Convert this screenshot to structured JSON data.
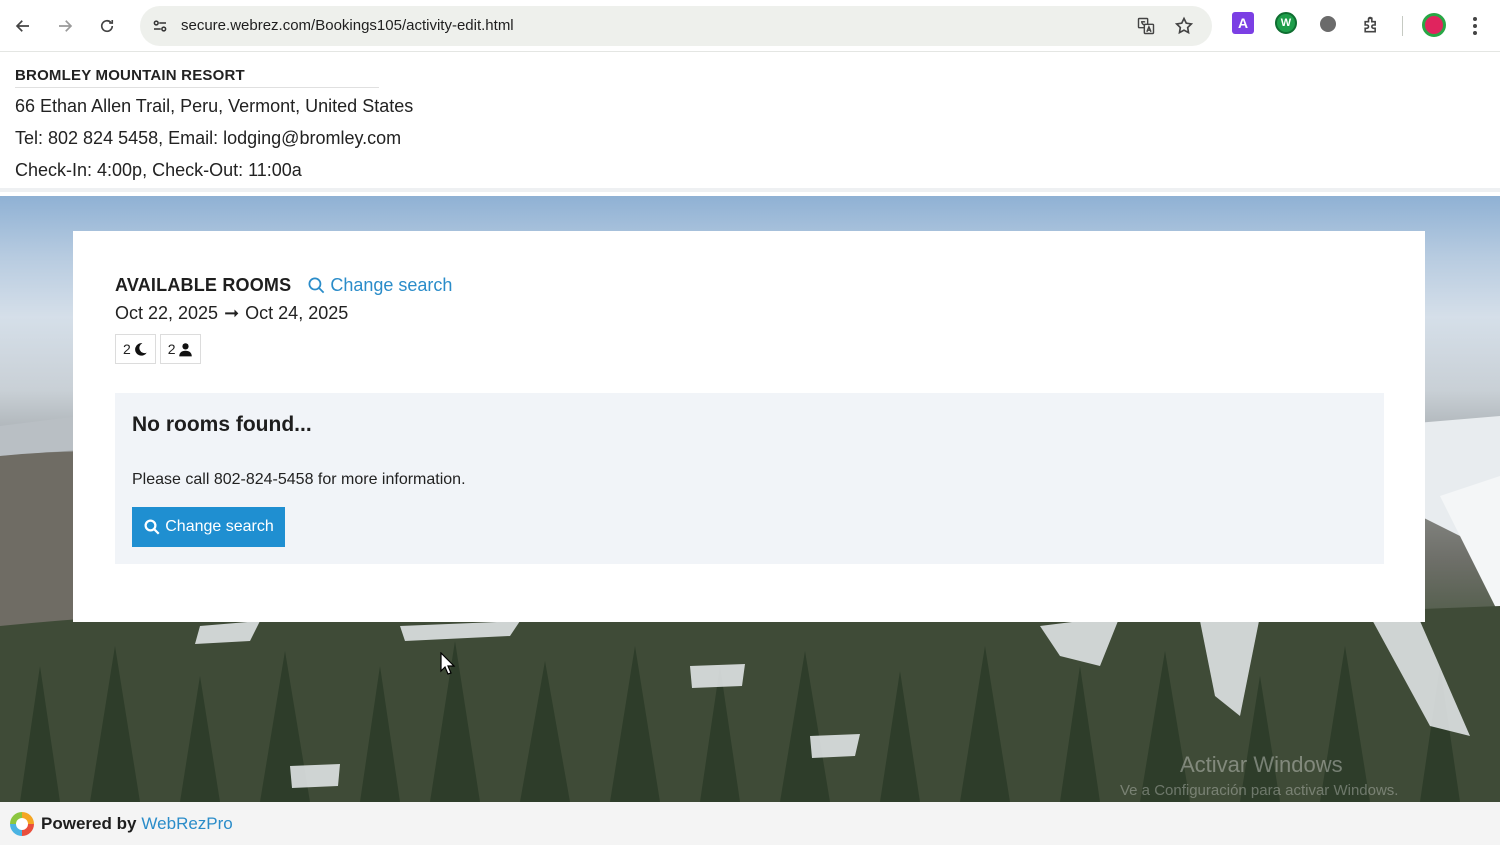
{
  "browser": {
    "url": "secure.webrez.com/Bookings105/activity-edit.html",
    "extension_a_label": "A",
    "extension_w_label": "W"
  },
  "resort": {
    "name": "BROMLEY MOUNTAIN RESORT",
    "address": "66 Ethan Allen Trail, Peru, Vermont, United States",
    "contact": "Tel: 802 824 5458, Email: lodging@bromley.com",
    "checkin": "Check-In: 4:00p, Check-Out: 11:00a"
  },
  "search": {
    "title": "AVAILABLE ROOMS",
    "change_link": "Change search",
    "date_from": "Oct 22, 2025",
    "date_arrow": "➞",
    "date_to": "Oct 24, 2025",
    "nights": "2",
    "guests": "2"
  },
  "result": {
    "heading": "No rooms found...",
    "message": "Please call 802-824-5458 for more information.",
    "button_label": "Change search"
  },
  "footer": {
    "powered_by": "Powered by",
    "brand": "WebRezPro"
  },
  "watermark": {
    "line1": "Activar Windows",
    "line2": "Ve a Configuración para activar Windows."
  },
  "colors": {
    "accent": "#1f8fd1",
    "link": "#2a8cc9",
    "result_bg": "#f1f4f8"
  },
  "icons": [
    "back-arrow-icon",
    "forward-arrow-icon",
    "reload-icon",
    "site-info-icon",
    "translate-icon",
    "star-icon",
    "extensions-icon",
    "search-icon",
    "moon-icon",
    "person-icon"
  ]
}
